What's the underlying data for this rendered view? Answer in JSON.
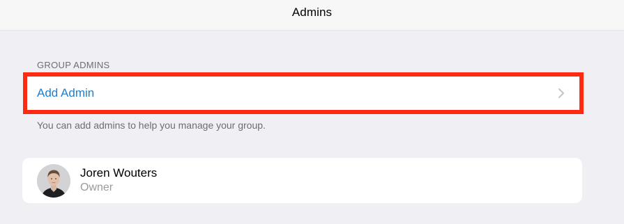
{
  "header": {
    "title": "Admins"
  },
  "group_admins": {
    "section_title": "GROUP ADMINS",
    "add_admin_label": "Add Admin",
    "footer_note": "You can add admins to help you manage your group."
  },
  "admins": [
    {
      "name": "Joren Wouters",
      "role": "Owner"
    }
  ],
  "colors": {
    "accent": "#1a7fd4",
    "highlight": "#ff2a12",
    "background": "#efeff4"
  },
  "icons": {
    "add_admin_chevron": "chevron-right-icon",
    "member_avatar": "avatar"
  }
}
